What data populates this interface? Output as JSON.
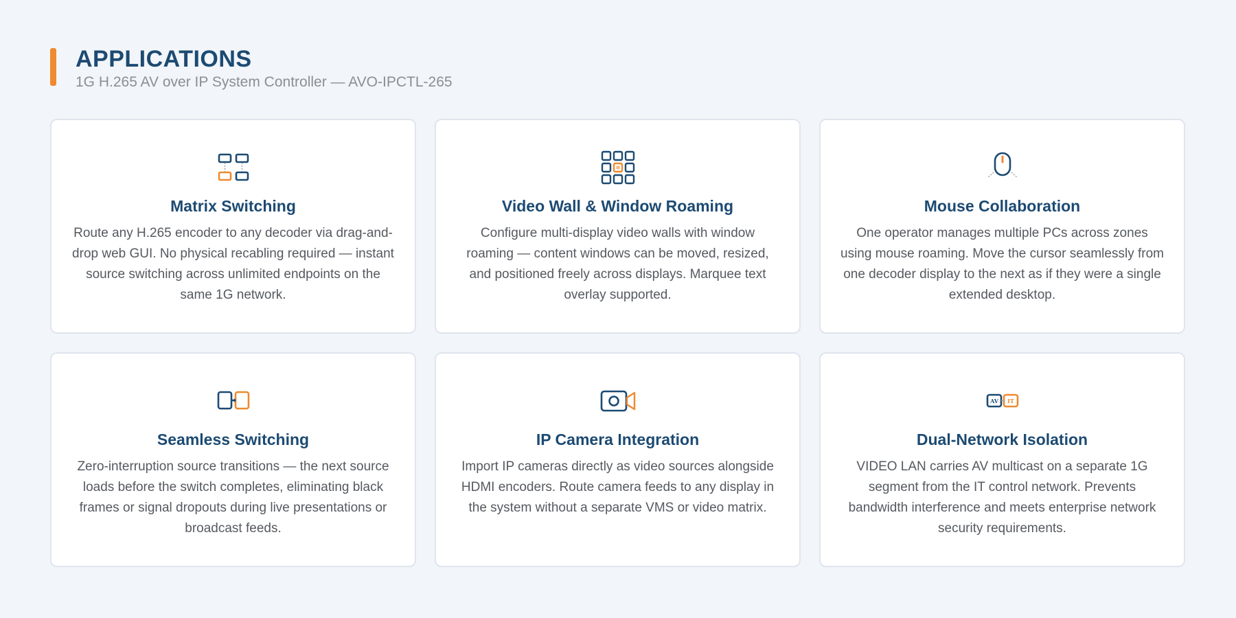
{
  "header": {
    "title": "APPLICATIONS",
    "subtitle": "1G H.265 AV over IP System Controller — AVO-IPCTL-265"
  },
  "colors": {
    "primary": "#1c4a72",
    "accent": "#ee8a2f",
    "background": "#f2f5f9",
    "card": "#ffffff",
    "text": "#55595f"
  },
  "cards": [
    {
      "icon": "matrix-switching-icon",
      "title": "Matrix Switching",
      "description": "Route any H.265 encoder to any decoder via drag-and-drop web GUI. No physical recabling required — instant source switching across unlimited endpoints on the same 1G network."
    },
    {
      "icon": "video-wall-icon",
      "title": "Video Wall & Window Roaming",
      "description": "Configure multi-display video walls with window roaming — content windows can be moved, resized, and positioned freely across displays. Marquee text overlay supported."
    },
    {
      "icon": "mouse-icon",
      "title": "Mouse Collaboration",
      "description": "One operator manages multiple PCs across zones using mouse roaming. Move the cursor seamlessly from one decoder display to the next as if they were a single extended desktop."
    },
    {
      "icon": "seamless-switch-icon",
      "title": "Seamless Switching",
      "description": "Zero-interruption source transitions — the next source loads before the switch completes, eliminating black frames or signal dropouts during live presentations or broadcast feeds."
    },
    {
      "icon": "ip-camera-icon",
      "title": "IP Camera Integration",
      "description": "Import IP cameras directly as video sources alongside HDMI encoders. Route camera feeds to any display in the system without a separate VMS or video matrix."
    },
    {
      "icon": "dual-network-icon",
      "title": "Dual-Network Isolation",
      "description": "VIDEO LAN carries AV multicast on a separate 1G segment from the IT control network. Prevents bandwidth interference and meets enterprise network security requirements.",
      "icon_labels": [
        "AV",
        "IT"
      ]
    }
  ]
}
